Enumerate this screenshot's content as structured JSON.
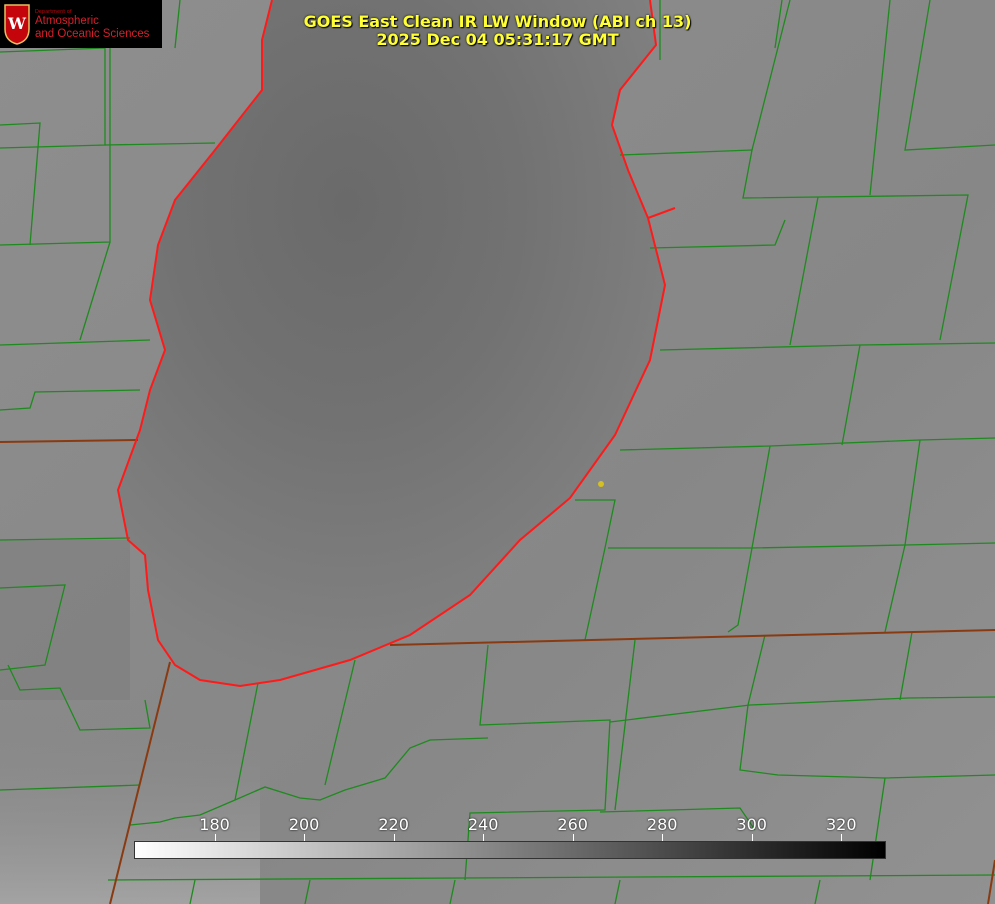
{
  "logo": {
    "department": "Department of",
    "name_line1": "Atmospheric",
    "name_line2": "and Oceanic Sciences",
    "seal_letter": "W"
  },
  "header": {
    "title": "GOES East Clean IR LW Window (ABI ch 13)",
    "timestamp": "2025 Dec 04 05:31:17 GMT"
  },
  "colorbar": {
    "ticks": [
      "180",
      "200",
      "220",
      "240",
      "260",
      "280",
      "300",
      "320"
    ],
    "range": [
      162,
      330
    ],
    "gradient_from": "#ffffff",
    "gradient_to": "#000000"
  },
  "colors": {
    "county_lines": "#1f8a1f",
    "shoreline": "#ff1a1a",
    "state_line": "#8a3a10",
    "title_text": "#ffff33",
    "marker": "#d4c020"
  }
}
